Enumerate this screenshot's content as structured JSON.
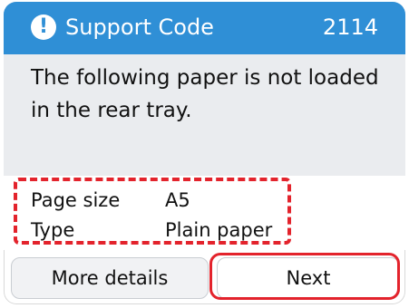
{
  "titlebar": {
    "title": "Support Code",
    "code": "2114",
    "icon": "exclamation-icon",
    "color": "#2f8fd6"
  },
  "message": "The following paper is not loaded in the rear tray.",
  "paper_info": {
    "size_label": "Page size",
    "size_value": "A5",
    "type_label": "Type",
    "type_value": "Plain paper"
  },
  "buttons": {
    "more_details": "More details",
    "next": "Next"
  },
  "highlight_color": "#e3232c"
}
